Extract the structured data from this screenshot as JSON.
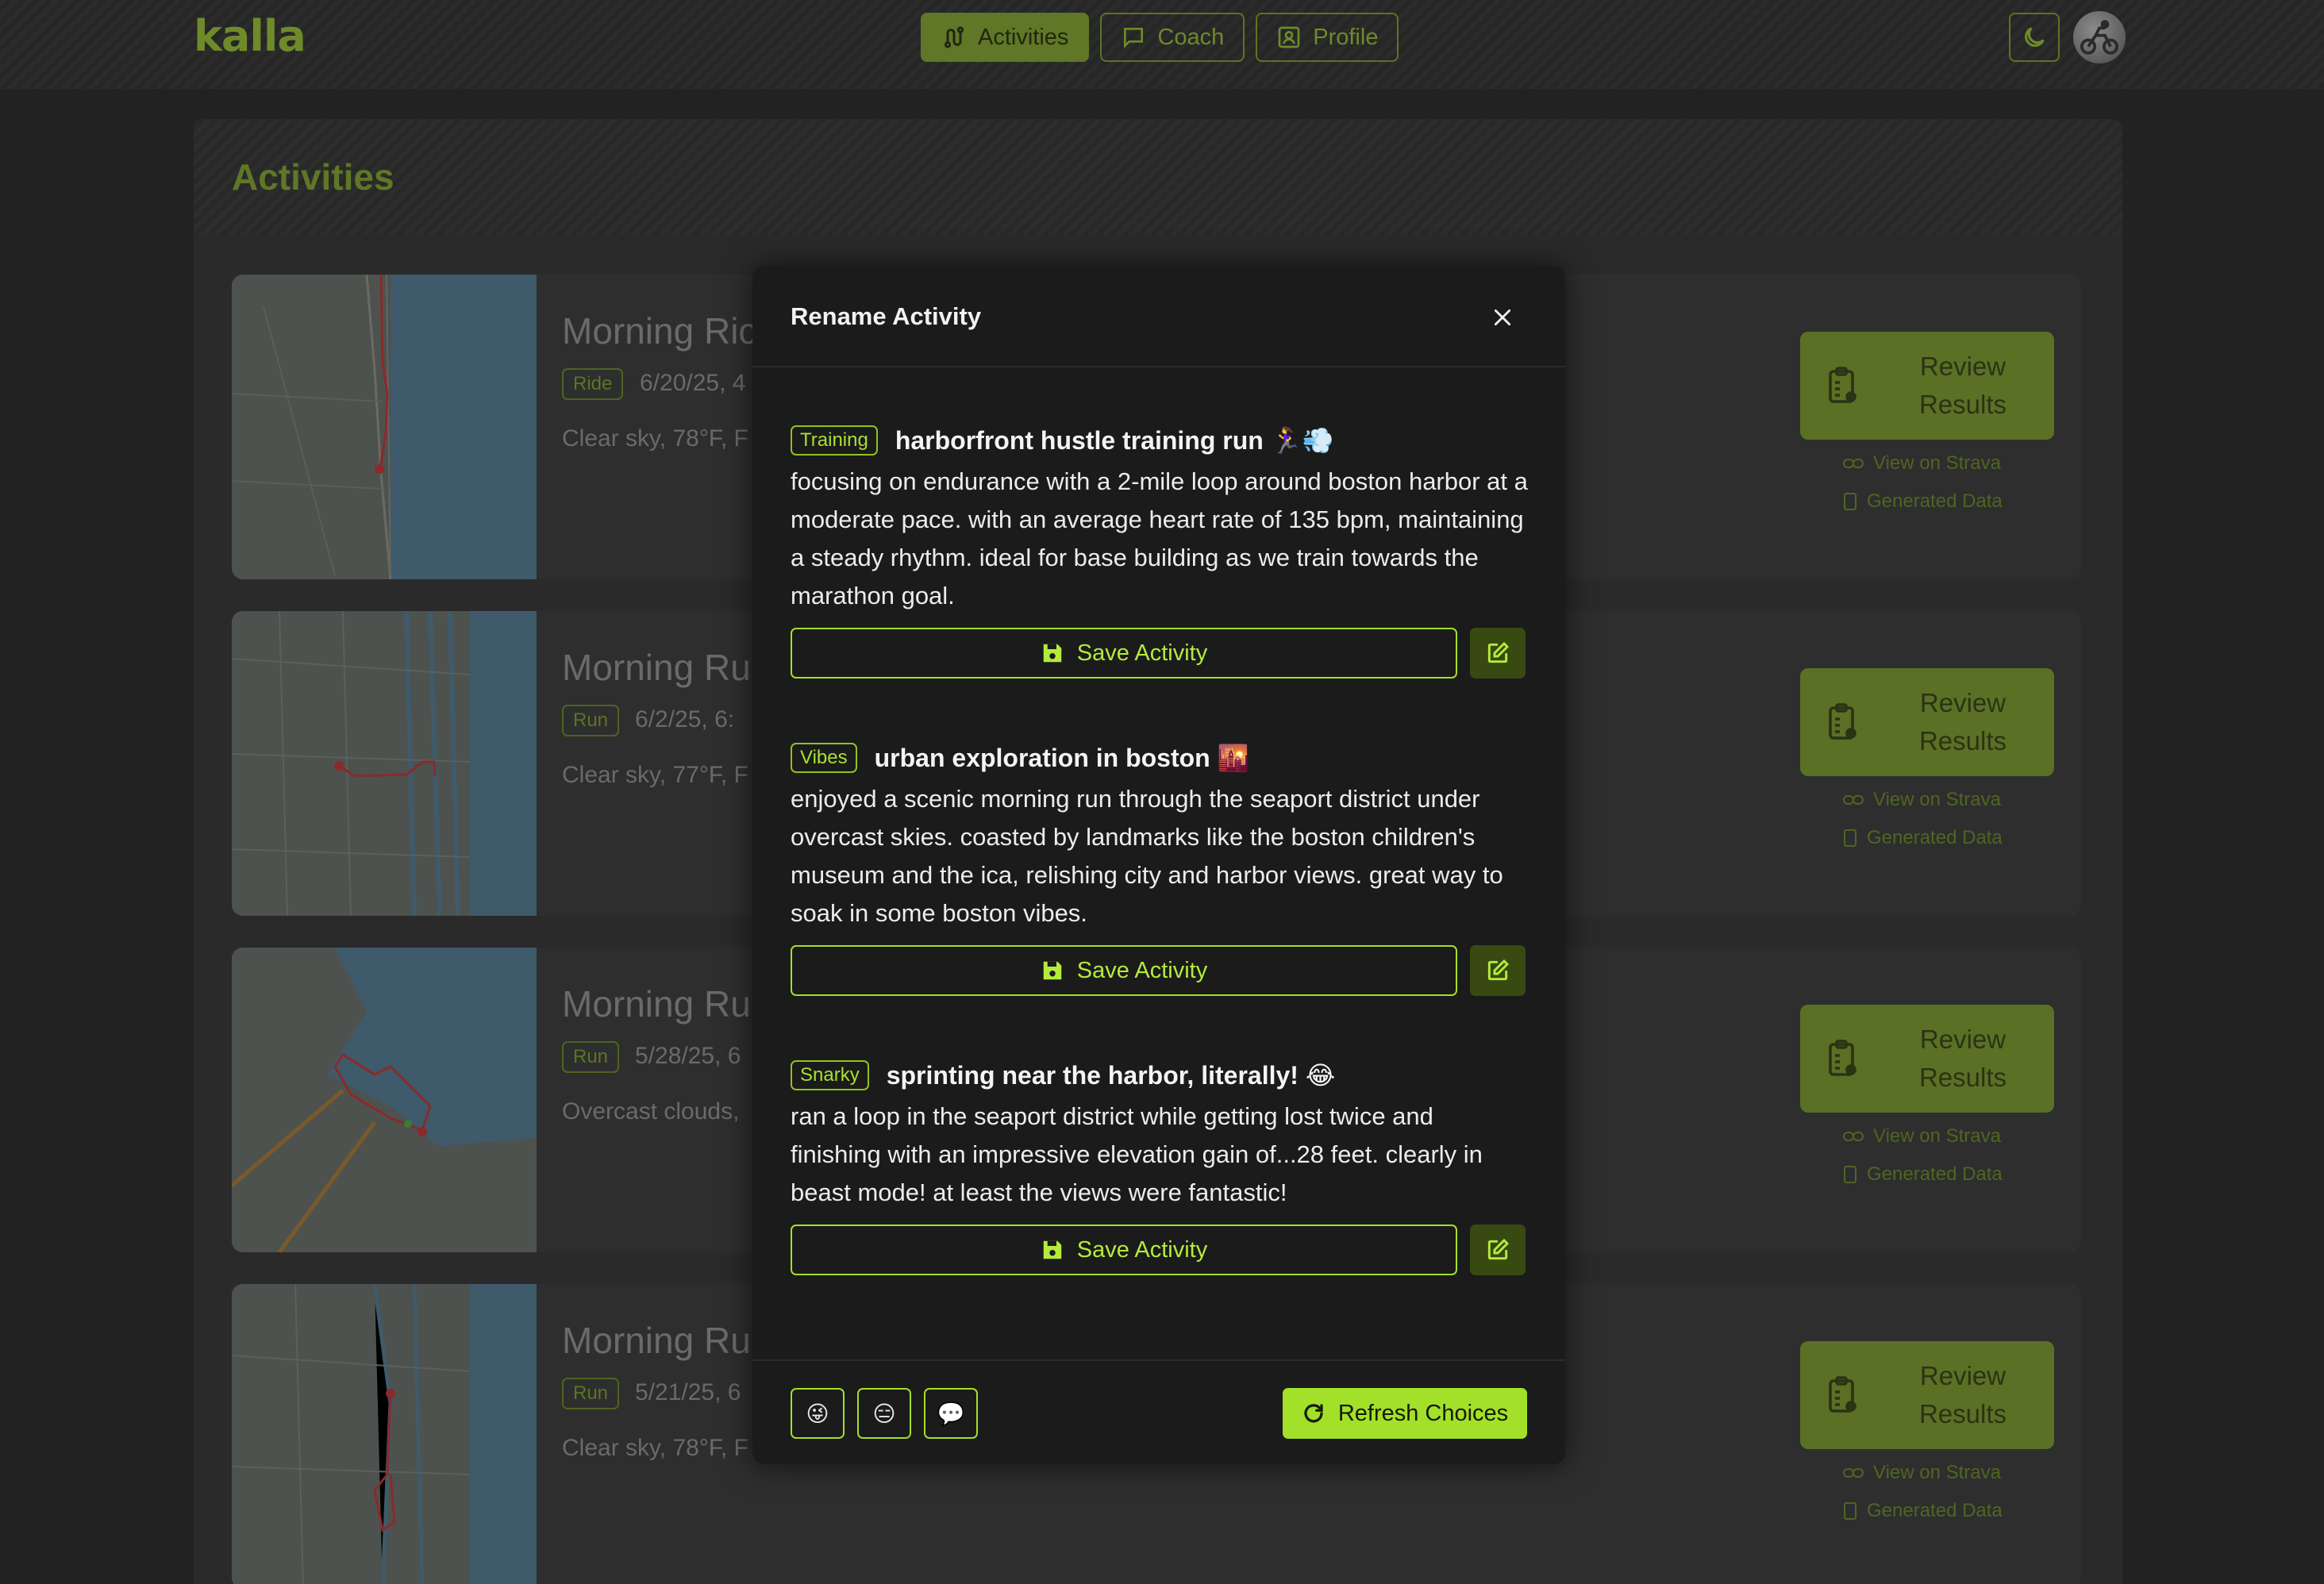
{
  "app": {
    "logo": "kalla"
  },
  "nav": {
    "items": [
      {
        "label": "Activities",
        "icon": "route-icon",
        "active": true
      },
      {
        "label": "Coach",
        "icon": "chat-icon",
        "active": false
      },
      {
        "label": "Profile",
        "icon": "profile-icon",
        "active": false
      }
    ]
  },
  "page": {
    "title": "Activities"
  },
  "activities": [
    {
      "title": "Morning Ric",
      "type": "Ride",
      "date": "6/20/25, 4",
      "weather": "Clear sky, 78°F, F"
    },
    {
      "title": "Morning Ru",
      "type": "Run",
      "date": "6/2/25, 6:",
      "weather": "Clear sky, 77°F, F"
    },
    {
      "title": "Morning Ru",
      "type": "Run",
      "date": "5/28/25, 6",
      "weather": "Overcast clouds,"
    },
    {
      "title": "Morning Ru",
      "type": "Run",
      "date": "5/21/25, 6",
      "weather": "Clear sky, 78°F, F"
    }
  ],
  "card_actions": {
    "review_line1": "Review",
    "review_line2": "Results",
    "strava_link": "View on Strava",
    "generated_link": "Generated Data"
  },
  "modal": {
    "title": "Rename Activity",
    "options": [
      {
        "tag": "Training",
        "title": "harborfront hustle training run 🏃‍♀️💨",
        "body": "focusing on endurance with a 2-mile loop around boston harbor at a moderate pace. with an average heart rate of 135 bpm, maintaining a steady rhythm. ideal for base building as we train towards the marathon goal.",
        "save_label": "Save Activity"
      },
      {
        "tag": "Vibes",
        "title": "urban exploration in boston 🌇",
        "body": "enjoyed a scenic morning run through the seaport district under overcast skies. coasted by landmarks like the boston children's museum and the ica, relishing city and harbor views. great way to soak in some boston vibes.",
        "save_label": "Save Activity"
      },
      {
        "tag": "Snarky",
        "title": "sprinting near the harbor, literally! 😂",
        "body": "ran a loop in the seaport district while getting lost twice and finishing with an impressive elevation gain of...28 feet. clearly in beast mode! at least the views were fantastic!",
        "save_label": "Save Activity"
      }
    ],
    "tone_buttons": [
      "😜",
      "😑",
      "💬"
    ],
    "refresh_label": "Refresh Choices"
  },
  "colors": {
    "accent": "#a3e02a",
    "accent_dim": "#5f7726",
    "modal_bg": "#1b1b1b",
    "page_bg": "#222222"
  }
}
